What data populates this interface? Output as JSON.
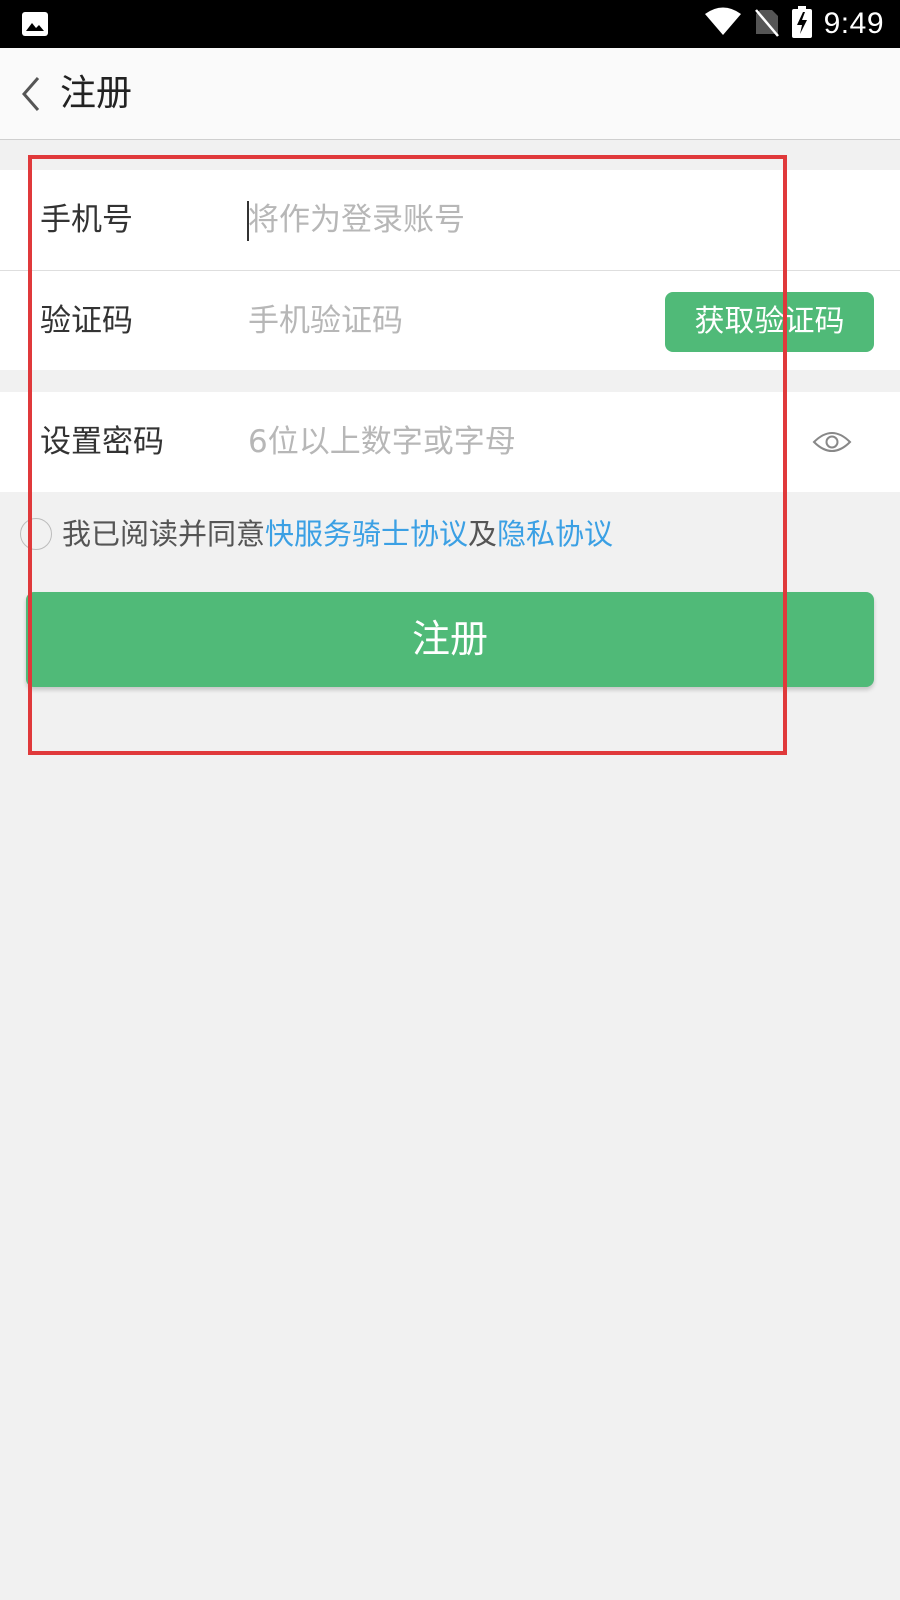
{
  "status_bar": {
    "time": "9:49",
    "icons": [
      "image-icon",
      "wifi-icon",
      "no-sim-icon",
      "battery-charging-icon"
    ]
  },
  "app_bar": {
    "title": "注册",
    "back_icon": "chevron-left-icon"
  },
  "form": {
    "phone": {
      "label": "手机号",
      "placeholder": "将作为登录账号",
      "value": ""
    },
    "code": {
      "label": "验证码",
      "placeholder": "手机验证码",
      "value": "",
      "button_label": "获取验证码"
    },
    "password": {
      "label": "设置密码",
      "placeholder": "6位以上数字或字母",
      "value": "",
      "toggle_icon": "eye-icon"
    }
  },
  "agreement": {
    "checked": false,
    "prefix": "我已阅读并同意",
    "link1": "快服务骑士协议",
    "conjunction": "及",
    "link2": "隐私协议"
  },
  "submit_label": "注册",
  "colors": {
    "primary_green": "#50ba78",
    "link_blue": "#3ba0e4",
    "highlight_red": "#e0393b"
  }
}
